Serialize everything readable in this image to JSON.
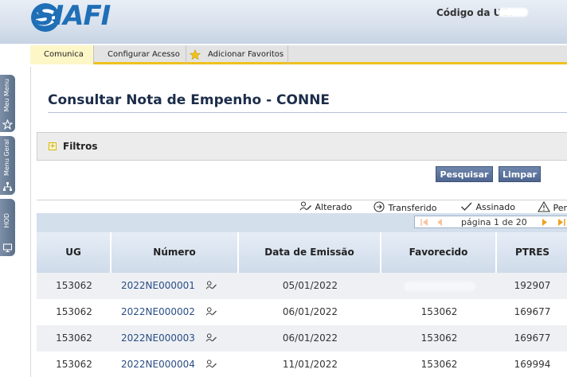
{
  "header": {
    "logo_text": "SIAFI",
    "ug_label": "Código da UG:"
  },
  "sidebar": {
    "tabs": [
      {
        "label": "Meu Menu",
        "icon": "star-outline-icon"
      },
      {
        "label": "Menu Geral",
        "icon": "sitemap-icon"
      },
      {
        "label": "HOD",
        "icon": "monitor-icon"
      }
    ]
  },
  "tabs": [
    {
      "label": "Comunica",
      "active": true
    },
    {
      "label": "Configurar Acesso",
      "active": false
    },
    {
      "label": "Adicionar Favoritos",
      "active": false,
      "icon": "star-icon"
    }
  ],
  "page": {
    "title": "Consultar Nota de Empenho - CONNE"
  },
  "filters": {
    "label": "Filtros"
  },
  "actions": {
    "search_label": "Pesquisar",
    "clear_label": "Limpar"
  },
  "legend": {
    "altered": "Alterado",
    "transferred": "Transferido",
    "signed": "Assinado",
    "pending": "Pen"
  },
  "pager": {
    "text": "página 1 de 20"
  },
  "table": {
    "columns": [
      "UG",
      "Número",
      "Data de Emissão",
      "Favorecido",
      "PTRES"
    ],
    "rows": [
      {
        "ug": "153062",
        "numero": "2022NE000001",
        "data": "05/01/2022",
        "favorecido": "",
        "ptres": "192907"
      },
      {
        "ug": "153062",
        "numero": "2022NE000002",
        "data": "06/01/2022",
        "favorecido": "153062",
        "ptres": "169677"
      },
      {
        "ug": "153062",
        "numero": "2022NE000003",
        "data": "06/01/2022",
        "favorecido": "153062",
        "ptres": "169677"
      },
      {
        "ug": "153062",
        "numero": "2022NE000004",
        "data": "11/01/2022",
        "favorecido": "153062",
        "ptres": "169994"
      }
    ]
  },
  "colors": {
    "brand": "#1f6fb6",
    "accent": "#f0c020",
    "button": "#4e6690",
    "link": "#2a4d85"
  }
}
